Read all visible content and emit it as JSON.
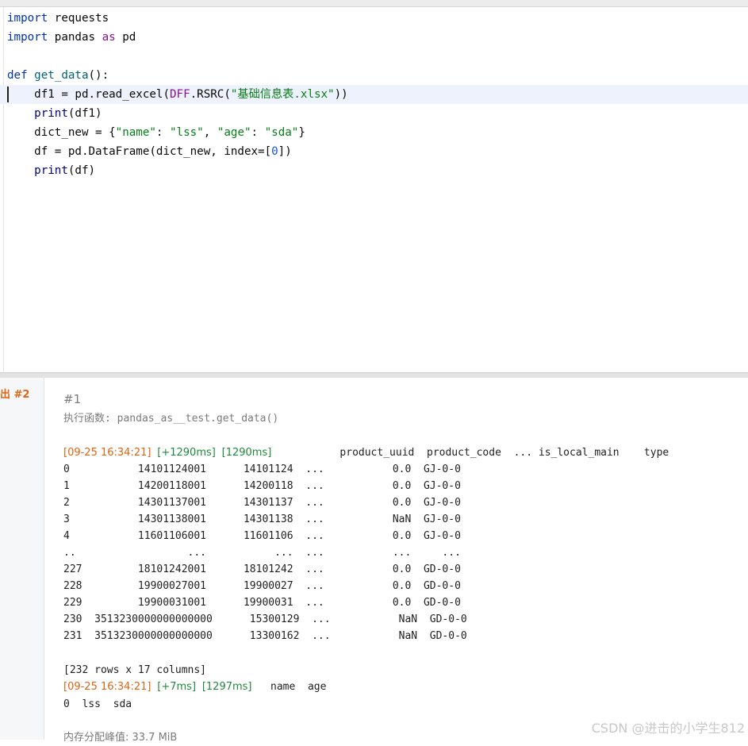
{
  "editor": {
    "lines": [
      [
        {
          "t": "import",
          "c": "kw"
        },
        {
          "t": " requests",
          "c": ""
        }
      ],
      [
        {
          "t": "import",
          "c": "kw"
        },
        {
          "t": " pandas ",
          "c": ""
        },
        {
          "t": "as",
          "c": "kw-purple"
        },
        {
          "t": " pd",
          "c": ""
        }
      ],
      [],
      [
        {
          "t": "def",
          "c": "kw"
        },
        {
          "t": " ",
          "c": ""
        },
        {
          "t": "get_data",
          "c": "fn"
        },
        {
          "t": "():",
          "c": ""
        }
      ],
      [
        {
          "t": "    df1 = pd.read_excel(",
          "c": ""
        },
        {
          "t": "DFF",
          "c": "kw-purple"
        },
        {
          "t": ".RSRC(",
          "c": ""
        },
        {
          "t": "\"基础信息表.xlsx\"",
          "c": "str"
        },
        {
          "t": "))",
          "c": ""
        }
      ],
      [
        {
          "t": "    ",
          "c": ""
        },
        {
          "t": "print",
          "c": "builtin"
        },
        {
          "t": "(df1)",
          "c": ""
        }
      ],
      [
        {
          "t": "    dict_new = {",
          "c": ""
        },
        {
          "t": "\"name\"",
          "c": "str"
        },
        {
          "t": ": ",
          "c": ""
        },
        {
          "t": "\"lss\"",
          "c": "str"
        },
        {
          "t": ", ",
          "c": ""
        },
        {
          "t": "\"age\"",
          "c": "str"
        },
        {
          "t": ": ",
          "c": ""
        },
        {
          "t": "\"sda\"",
          "c": "str"
        },
        {
          "t": "}",
          "c": ""
        }
      ],
      [
        {
          "t": "    df = pd.DataFrame(dict_new, index=[",
          "c": ""
        },
        {
          "t": "0",
          "c": "num"
        },
        {
          "t": "])",
          "c": ""
        }
      ],
      [
        {
          "t": "    ",
          "c": ""
        },
        {
          "t": "print",
          "c": "builtin"
        },
        {
          "t": "(df)",
          "c": ""
        }
      ]
    ],
    "current_line": 4
  },
  "panel": {
    "tab_label": "出 #2",
    "run_id": "#1",
    "exec_label": "执行函数: ",
    "exec_func": "pandas_as__test.get_data()",
    "log1": {
      "ts": "[09-25 16:34:21]",
      "delta": "[+1290ms]",
      "total": "[1290ms]",
      "header": "           product_uuid  product_code  ... is_local_main    type"
    },
    "rows": [
      "0           14101124001      14101124  ...           0.0  GJ-0-0",
      "1           14200118001      14200118  ...           0.0  GJ-0-0",
      "2           14301137001      14301137  ...           0.0  GJ-0-0",
      "3           14301138001      14301138  ...           NaN  GJ-0-0",
      "4           11601106001      11601106  ...           0.0  GJ-0-0",
      "..                  ...           ...  ...           ...     ...",
      "227         18101242001      18101242  ...           0.0  GD-0-0",
      "228         19900027001      19900027  ...           0.0  GD-0-0",
      "229         19900031001      19900031  ...           0.0  GD-0-0",
      "230  3513230000000000000      15300129  ...           NaN  GD-0-0",
      "231  3513230000000000000      13300162  ...           NaN  GD-0-0"
    ],
    "shape": "[232 rows x 17 columns]",
    "log2": {
      "ts": "[09-25 16:34:21]",
      "delta": "[+7ms]",
      "total": "[1297ms]",
      "header": "   name  age"
    },
    "row2": "0  lss  sda",
    "memory": "内存分配峰值: 33.7 MiB"
  },
  "watermark": "CSDN @进击的小学生812"
}
